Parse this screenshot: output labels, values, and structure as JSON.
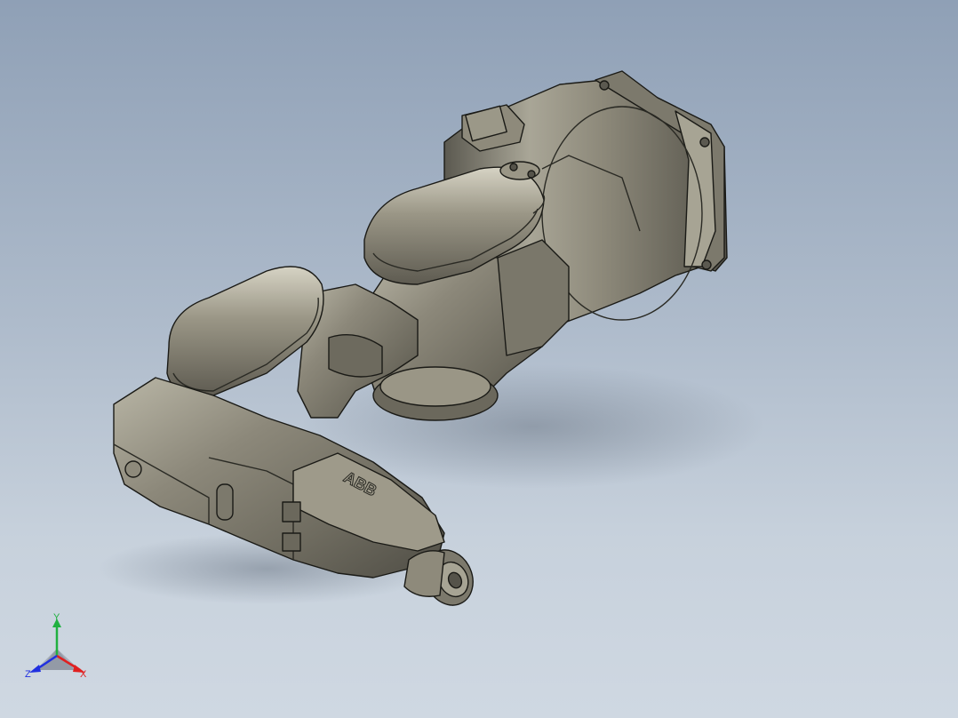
{
  "viewport": {
    "background_top": "#8fa0b6",
    "background_bottom": "#cfd8e2"
  },
  "model": {
    "body_color": "#8a8676",
    "edge_color": "#1a1a16",
    "logo_text": "ABB"
  },
  "triad": {
    "x_label": "X",
    "y_label": "Y",
    "z_label": "Z",
    "x_color": "#e02020",
    "y_color": "#20b040",
    "z_color": "#2030e0"
  }
}
